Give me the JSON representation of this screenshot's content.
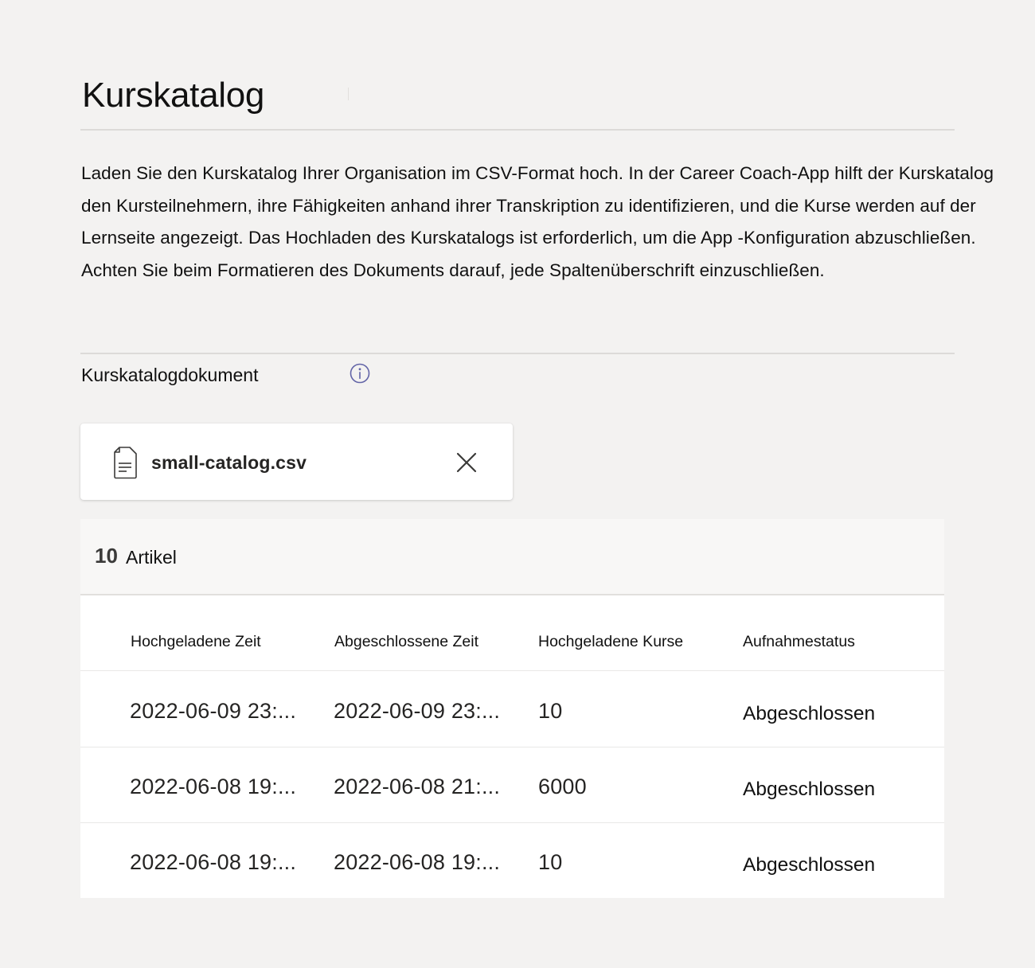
{
  "page": {
    "title": "Kurskatalog",
    "description": "Laden Sie den Kurskatalog Ihrer Organisation im CSV-Format hoch. In der Career Coach-App hilft der Kurskatalog den Kursteilnehmern, ihre Fähigkeiten anhand ihrer Transkription zu identifizieren, und die Kurse werden auf der Lernseite angezeigt. Das Hochladen des Kurskatalogs ist erforderlich, um die App -Konfiguration abzuschließen. Achten Sie beim Formatieren des Dokuments darauf, jede Spaltenüberschrift einzuschließen."
  },
  "document_field": {
    "label": "Kurskatalogdokument",
    "info_icon": "info-circle-icon"
  },
  "file": {
    "name": "small-catalog.csv",
    "file_icon": "document-icon",
    "remove_icon": "close-icon"
  },
  "table": {
    "count": "10",
    "count_label": "Artikel",
    "columns": [
      "Hochgeladene Zeit",
      "Abgeschlossene Zeit",
      "Hochgeladene Kurse",
      "Aufnahmestatus"
    ],
    "rows": [
      {
        "uploaded": "2022-06-09 23:...",
        "completed": "2022-06-09 23:...",
        "courses": "10",
        "status": "Abgeschlossen"
      },
      {
        "uploaded": "2022-06-08 19:...",
        "completed": "2022-06-08 21:...",
        "courses": "6000",
        "status": "Abgeschlossen"
      },
      {
        "uploaded": "2022-06-08 19:...",
        "completed": "2022-06-08 19:...",
        "courses": "10",
        "status": "Abgeschlossen"
      }
    ]
  },
  "colors": {
    "background": "#f3f2f1",
    "card": "#ffffff",
    "info_icon": "#6264a7",
    "divider": "#dcdad8"
  }
}
